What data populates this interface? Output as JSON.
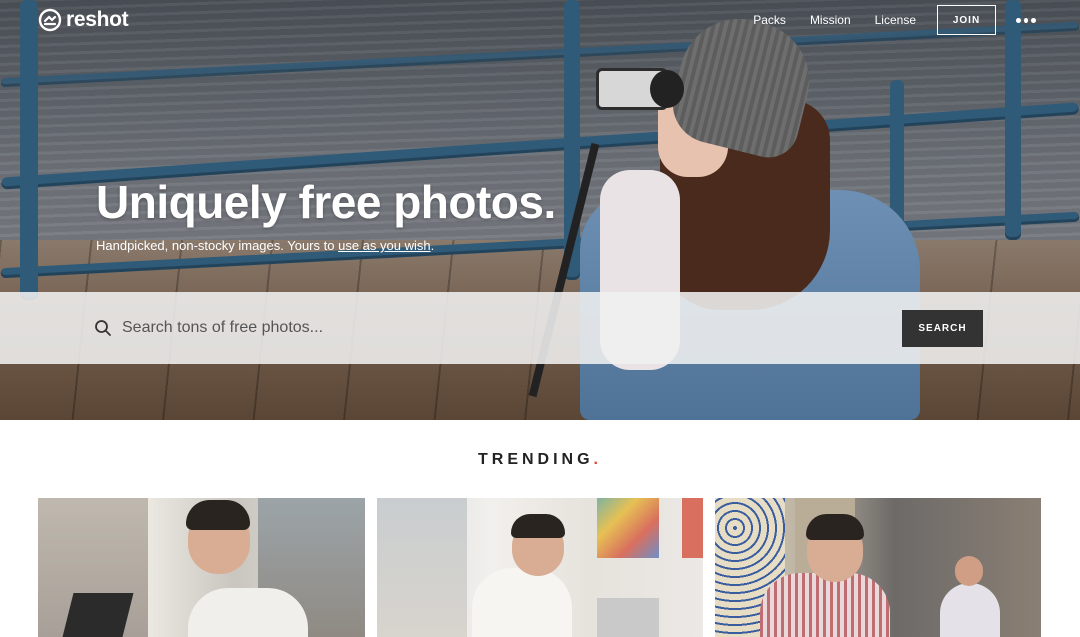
{
  "header": {
    "logo_text": "reshot",
    "nav": [
      "Packs",
      "Mission",
      "License"
    ],
    "join_label": "JOIN"
  },
  "hero": {
    "title": "Uniquely free photos.",
    "subtitle_before": "Handpicked, non-stocky images. Yours to ",
    "subtitle_link": "use as you wish",
    "subtitle_after": "."
  },
  "search": {
    "placeholder": "Search tons of free photos...",
    "value": "",
    "button_label": "SEARCH"
  },
  "trending": {
    "heading": "TRENDING",
    "dot": ".",
    "accent_color": "#e0402f"
  },
  "icons": [
    "logo-icon",
    "more-icon",
    "search-icon"
  ],
  "colors": {
    "search_button": "#333333",
    "accent": "#e0402f"
  }
}
